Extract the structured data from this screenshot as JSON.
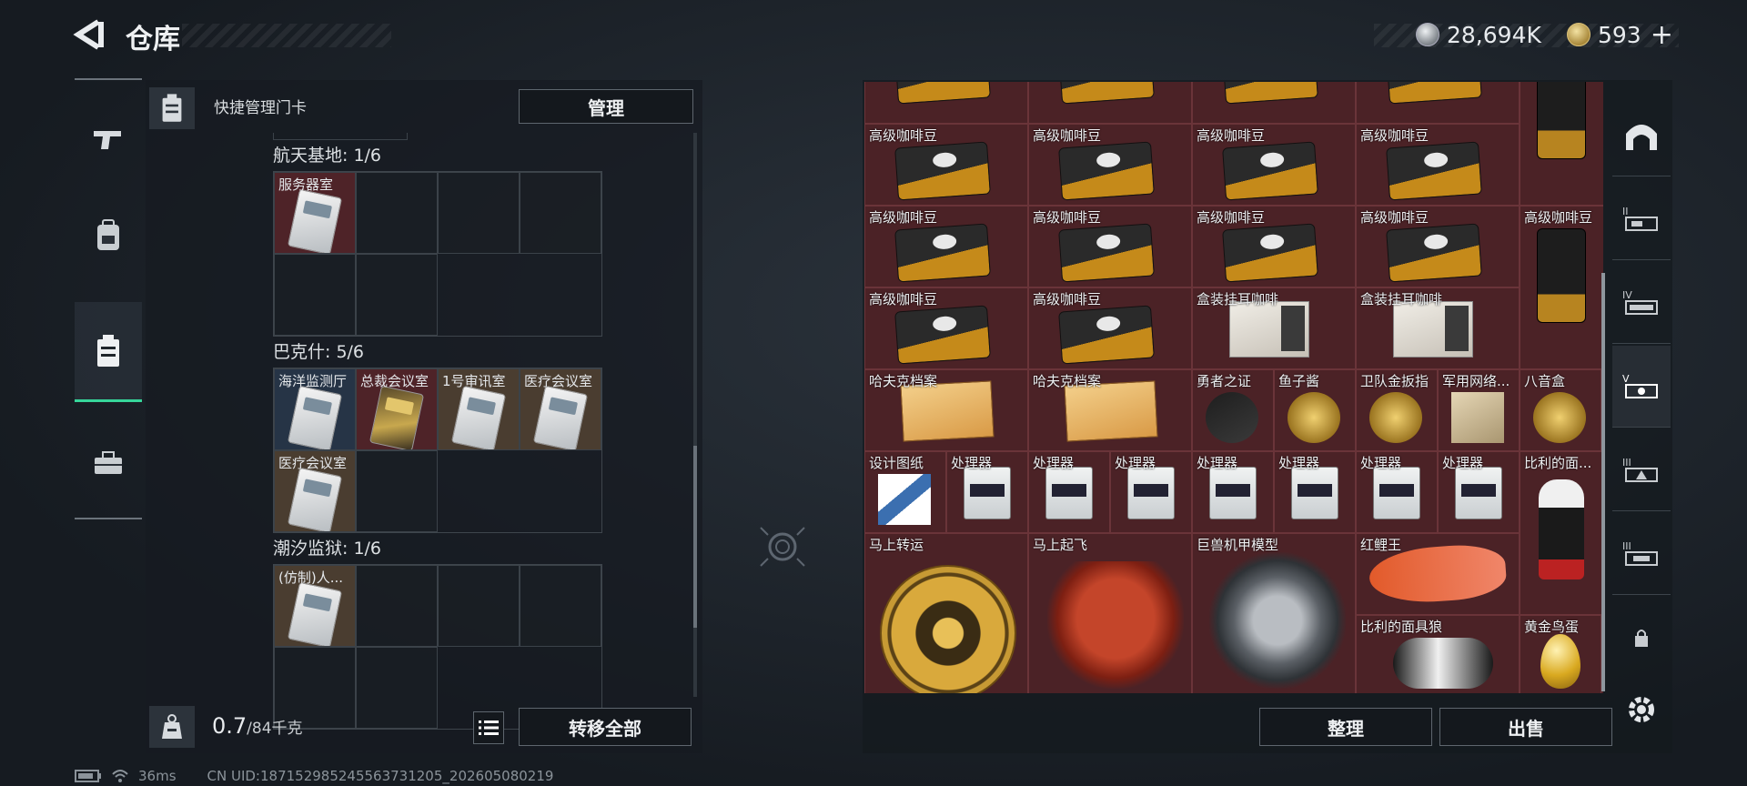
{
  "header": {
    "title": "仓库",
    "currency_silver": "28,694K",
    "currency_gold": "593",
    "gold_plus": "+"
  },
  "left_panel": {
    "header_label": "快捷管理门卡",
    "manage_button": "管理",
    "sections": [
      {
        "title": "航天基地: 1/6",
        "cells": [
          {
            "label": "服务器室",
            "card": "white",
            "bg": "red"
          },
          {
            "label": "",
            "card": "",
            "bg": "empty"
          },
          {
            "label": "",
            "card": "",
            "bg": "empty"
          },
          {
            "label": "",
            "card": "",
            "bg": "empty"
          },
          {
            "label": "",
            "card": "",
            "bg": "empty"
          },
          {
            "label": "",
            "card": "",
            "bg": "empty"
          }
        ]
      },
      {
        "title": "巴克什: 5/6",
        "cells": [
          {
            "label": "海洋监测厅",
            "card": "white",
            "bg": "blue"
          },
          {
            "label": "总裁会议室",
            "card": "gold",
            "bg": "red"
          },
          {
            "label": "1号审讯室",
            "card": "white",
            "bg": "brown"
          },
          {
            "label": "医疗会议室",
            "card": "white",
            "bg": "brown"
          },
          {
            "label": "医疗会议室",
            "card": "white",
            "bg": "brown"
          },
          {
            "label": "",
            "card": "",
            "bg": "empty"
          }
        ]
      },
      {
        "title": "潮汐监狱: 1/6",
        "cells": [
          {
            "label": "(仿制)人...",
            "card": "white",
            "bg": "brown"
          },
          {
            "label": "",
            "card": "",
            "bg": "empty"
          },
          {
            "label": "",
            "card": "",
            "bg": "empty"
          },
          {
            "label": "",
            "card": "",
            "bg": "empty"
          },
          {
            "label": "",
            "card": "",
            "bg": "empty"
          },
          {
            "label": "",
            "card": "",
            "bg": "empty"
          }
        ]
      }
    ],
    "weight_current": "0.7",
    "weight_max": "/84千克",
    "transfer_all_button": "转移全部"
  },
  "status_bar": {
    "ping": "36ms",
    "uid": "CN UID:18715298524556373120​5_202605080219"
  },
  "stash": {
    "sort_button": "整理",
    "sell_button": "出售",
    "items": [
      {
        "label": "",
        "kind": "coffee",
        "c": 0,
        "r": 0,
        "w": 1,
        "h": 1,
        "cut": true
      },
      {
        "label": "",
        "kind": "coffee",
        "c": 1,
        "r": 0,
        "w": 1,
        "h": 1,
        "cut": true
      },
      {
        "label": "",
        "kind": "coffee",
        "c": 2,
        "r": 0,
        "w": 1,
        "h": 1,
        "cut": true
      },
      {
        "label": "",
        "kind": "coffee",
        "c": 3,
        "r": 0,
        "w": 1,
        "h": 1,
        "cut": true
      },
      {
        "label": "",
        "kind": "coffee-tall",
        "c": 4,
        "r": 0,
        "w": 1,
        "h": 2,
        "cut": true
      },
      {
        "label": "高级咖啡豆",
        "kind": "coffee",
        "c": 0,
        "r": 1,
        "w": 1,
        "h": 1
      },
      {
        "label": "高级咖啡豆",
        "kind": "coffee",
        "c": 1,
        "r": 1,
        "w": 1,
        "h": 1
      },
      {
        "label": "高级咖啡豆",
        "kind": "coffee",
        "c": 2,
        "r": 1,
        "w": 1,
        "h": 1
      },
      {
        "label": "高级咖啡豆",
        "kind": "coffee",
        "c": 3,
        "r": 1,
        "w": 1,
        "h": 1
      },
      {
        "label": "高级咖啡豆",
        "kind": "coffee",
        "c": 0,
        "r": 2,
        "w": 1,
        "h": 1
      },
      {
        "label": "高级咖啡豆",
        "kind": "coffee",
        "c": 1,
        "r": 2,
        "w": 1,
        "h": 1
      },
      {
        "label": "高级咖啡豆",
        "kind": "coffee",
        "c": 2,
        "r": 2,
        "w": 1,
        "h": 1
      },
      {
        "label": "高级咖啡豆",
        "kind": "coffee",
        "c": 3,
        "r": 2,
        "w": 1,
        "h": 1
      },
      {
        "label": "高级咖啡豆",
        "kind": "coffee-tall",
        "c": 4,
        "r": 2,
        "w": 1,
        "h": 2
      },
      {
        "label": "高级咖啡豆",
        "kind": "coffee",
        "c": 0,
        "r": 3,
        "w": 1,
        "h": 1
      },
      {
        "label": "高级咖啡豆",
        "kind": "coffee",
        "c": 1,
        "r": 3,
        "w": 1,
        "h": 1
      },
      {
        "label": "盒装挂耳咖啡",
        "kind": "box",
        "c": 2,
        "r": 3,
        "w": 1,
        "h": 1
      },
      {
        "label": "盒装挂耳咖啡",
        "kind": "box",
        "c": 3,
        "r": 3,
        "w": 1,
        "h": 1
      },
      {
        "label": "哈夫克档案",
        "kind": "folder",
        "c": 0,
        "r": 4,
        "w": 1,
        "h": 1
      },
      {
        "label": "哈夫克档案",
        "kind": "folder",
        "c": 1,
        "r": 4,
        "w": 1,
        "h": 1
      },
      {
        "label": "勇者之证",
        "kind": "small-dark",
        "c": 2,
        "r": 4,
        "w": 0.5,
        "h": 1
      },
      {
        "label": "鱼子酱",
        "kind": "small-gold",
        "c": 2.5,
        "r": 4,
        "w": 0.5,
        "h": 1
      },
      {
        "label": "卫队金扳指",
        "kind": "small-gold",
        "c": 3,
        "r": 4,
        "w": 0.5,
        "h": 1
      },
      {
        "label": "军用网络...",
        "kind": "small-tan",
        "c": 3.5,
        "r": 4,
        "w": 0.5,
        "h": 1
      },
      {
        "label": "八音盒",
        "kind": "small-gold",
        "c": 4,
        "r": 4,
        "w": 0.5,
        "h": 1
      },
      {
        "label": "设计图纸",
        "kind": "small-blue",
        "c": 0,
        "r": 5,
        "w": 0.5,
        "h": 1
      },
      {
        "label": "处理器",
        "kind": "proc",
        "c": 0.5,
        "r": 5,
        "w": 0.5,
        "h": 1
      },
      {
        "label": "处理器",
        "kind": "proc",
        "c": 1,
        "r": 5,
        "w": 0.5,
        "h": 1
      },
      {
        "label": "处理器",
        "kind": "proc",
        "c": 1.5,
        "r": 5,
        "w": 0.5,
        "h": 1
      },
      {
        "label": "处理器",
        "kind": "proc",
        "c": 2,
        "r": 5,
        "w": 0.5,
        "h": 1
      },
      {
        "label": "处理器",
        "kind": "proc",
        "c": 2.5,
        "r": 5,
        "w": 0.5,
        "h": 1
      },
      {
        "label": "处理器",
        "kind": "proc",
        "c": 3,
        "r": 5,
        "w": 0.5,
        "h": 1
      },
      {
        "label": "处理器",
        "kind": "proc",
        "c": 3.5,
        "r": 5,
        "w": 0.5,
        "h": 1
      },
      {
        "label": "比利的面...",
        "kind": "puppet",
        "c": 4,
        "r": 5,
        "w": 1,
        "h": 2
      },
      {
        "label": "马上转运",
        "kind": "wheel",
        "c": 0,
        "r": 6,
        "w": 1,
        "h": 2
      },
      {
        "label": "马上起飞",
        "kind": "horse",
        "c": 1,
        "r": 6,
        "w": 1,
        "h": 2
      },
      {
        "label": "巨兽机甲模型",
        "kind": "mech",
        "c": 2,
        "r": 6,
        "w": 1,
        "h": 2
      },
      {
        "label": "红鲤王",
        "kind": "fish",
        "c": 3,
        "r": 6,
        "w": 1,
        "h": 1
      },
      {
        "label": "比利的面具狼",
        "kind": "puppet-wide",
        "c": 3,
        "r": 7,
        "w": 1,
        "h": 1
      },
      {
        "label": "黄金鸟蛋",
        "kind": "egg",
        "c": 4,
        "r": 7,
        "w": 0.5,
        "h": 1
      }
    ]
  }
}
